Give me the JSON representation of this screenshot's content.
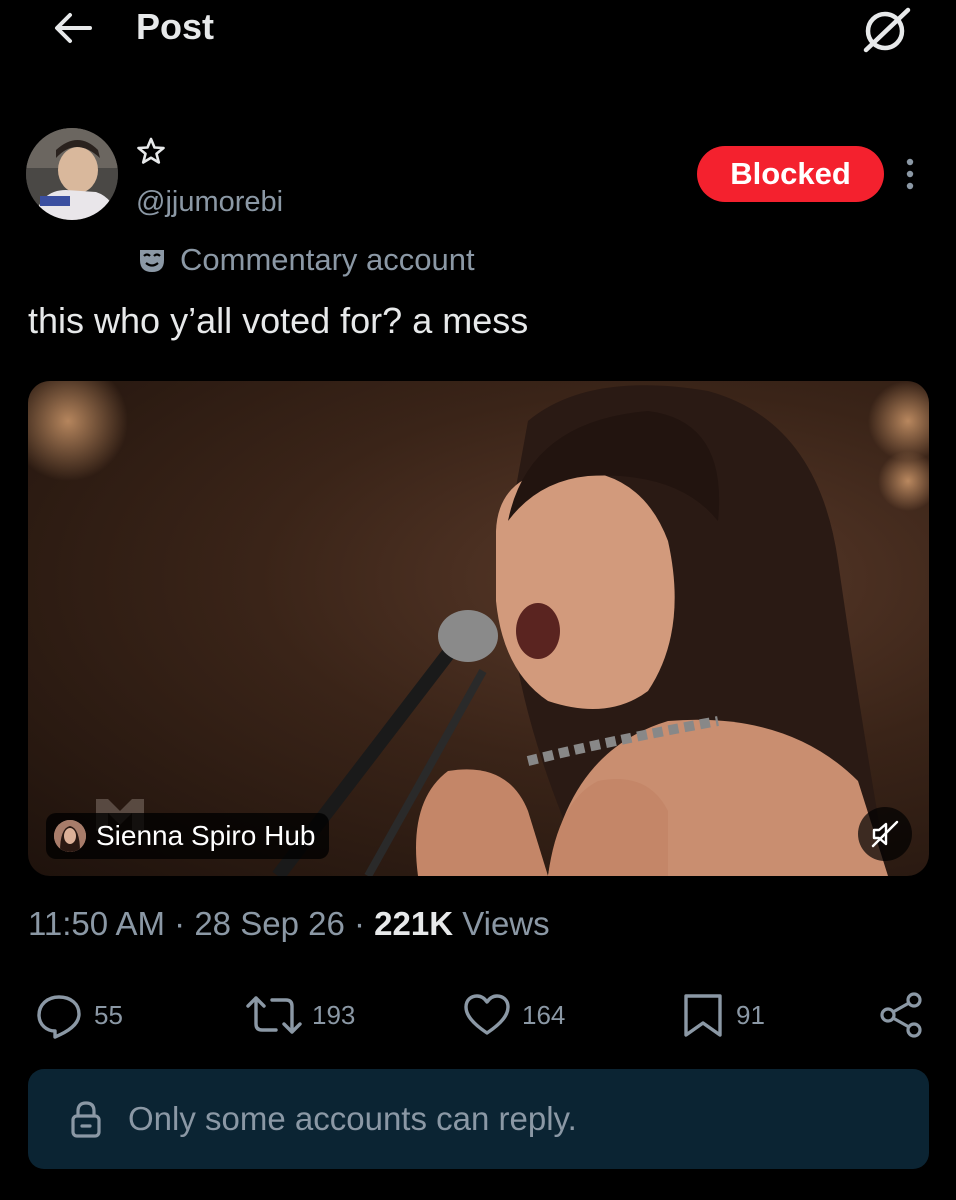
{
  "header": {
    "title": "Post"
  },
  "post": {
    "handle": "@jjumorebi",
    "blocked_label": "Blocked",
    "label_badge": "Commentary account",
    "text": "this who y’all voted for? a mess",
    "media": {
      "source_chip": "Sienna Spiro Hub",
      "muted": true
    },
    "meta": {
      "time": "11:50 AM",
      "date": "28 Sep 26",
      "views_count": "221K",
      "views_label": "Views"
    },
    "actions": {
      "replies": "55",
      "reposts": "193",
      "likes": "164",
      "bookmarks": "91"
    }
  },
  "reply_restriction": "Only some accounts can reply.",
  "colors": {
    "background": "#000000",
    "blocked": "#f4212e",
    "secondary_text": "#8b98a5",
    "banner": "#0b2433"
  },
  "icons": [
    "back-arrow-icon",
    "grok-icon",
    "star-icon",
    "more-icon",
    "mask-icon",
    "mute-icon",
    "reply-icon",
    "repost-icon",
    "like-icon",
    "bookmark-icon",
    "share-icon",
    "lock-icon"
  ]
}
